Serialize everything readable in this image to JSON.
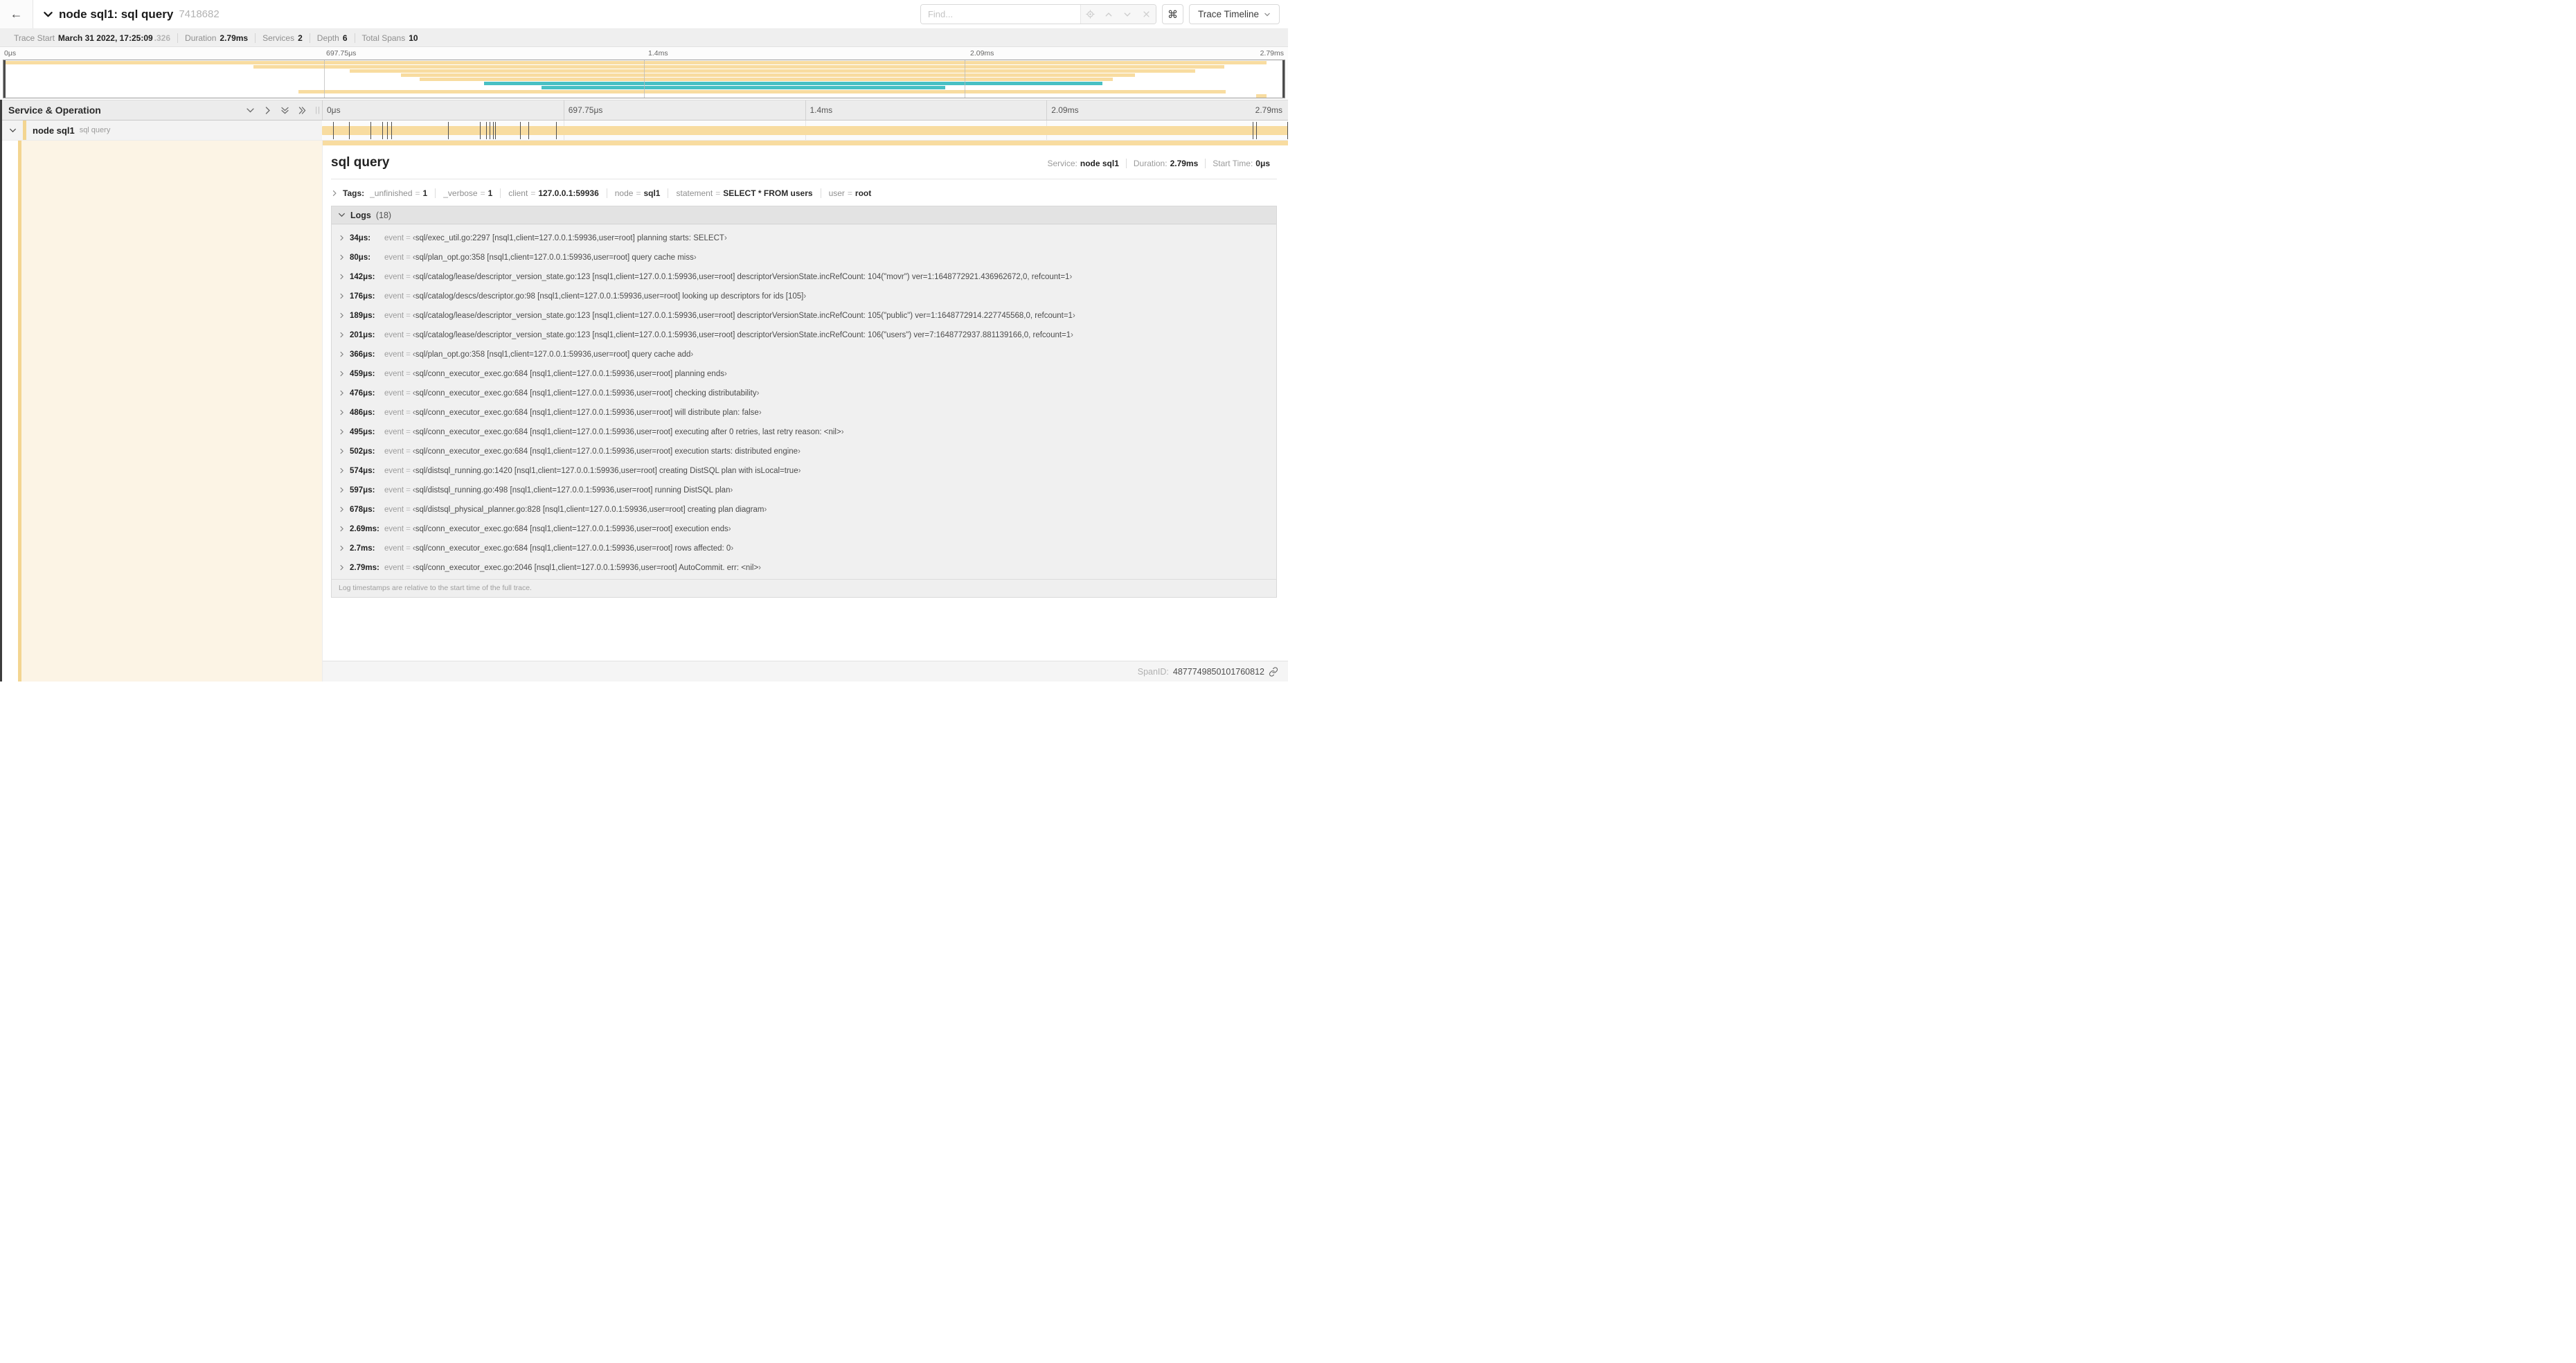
{
  "header": {
    "back_label": "←",
    "title": "node sql1: sql query",
    "trace_id": "7418682",
    "find_placeholder": "Find...",
    "shortcut_key": "⌘",
    "view_selector": "Trace Timeline"
  },
  "stats": [
    {
      "label": "Trace Start",
      "value": "March 31 2022, 17:25:09",
      "suffix": ".326"
    },
    {
      "label": "Duration",
      "value": "2.79ms"
    },
    {
      "label": "Services",
      "value": "2"
    },
    {
      "label": "Depth",
      "value": "6"
    },
    {
      "label": "Total Spans",
      "value": "10"
    }
  ],
  "colors": {
    "span_tan": "#f8dca0",
    "span_teal": "#48c0c4",
    "accent_stripe": "#f3d591",
    "detail_cream": "#fcf4e5"
  },
  "minimap": {
    "total_us": 2790,
    "ticks": [
      {
        "label": "0μs",
        "pos": 0
      },
      {
        "label": "697.75μs",
        "pos": 25
      },
      {
        "label": "1.4ms",
        "pos": 50
      },
      {
        "label": "2.09ms",
        "pos": 75
      },
      {
        "label": "2.79ms",
        "pos": 100
      }
    ],
    "spans": [
      {
        "row": 0,
        "start": 0,
        "end": 98.6,
        "color": "tan"
      },
      {
        "row": 1,
        "start": 19.5,
        "end": 95.3,
        "color": "tan"
      },
      {
        "row": 2,
        "start": 27,
        "end": 93,
        "color": "tan"
      },
      {
        "row": 3,
        "start": 31,
        "end": 88.3,
        "color": "tan"
      },
      {
        "row": 4,
        "start": 32.5,
        "end": 86.6,
        "color": "tan"
      },
      {
        "row": 5,
        "start": 37.5,
        "end": 85.8,
        "color": "teal"
      },
      {
        "row": 6,
        "start": 42,
        "end": 73.5,
        "color": "teal"
      },
      {
        "row": 7,
        "start": 23,
        "end": 95.4,
        "color": "tan"
      },
      {
        "row": 8,
        "start": 97.8,
        "end": 98.6,
        "color": "tan"
      }
    ]
  },
  "timeline": {
    "left_header": "Service & Operation",
    "resizer_glyph": "||",
    "ticks": [
      "0μs",
      "697.75μs",
      "1.4ms",
      "2.09ms",
      "2.79ms"
    ],
    "row": {
      "service": "node sql1",
      "operation": "sql query"
    }
  },
  "detail": {
    "title": "sql query",
    "meta": [
      {
        "label": "Service:",
        "value": "node sql1"
      },
      {
        "label": "Duration:",
        "value": "2.79ms"
      },
      {
        "label": "Start Time:",
        "value": "0μs"
      }
    ],
    "tags_label": "Tags:",
    "tags": [
      {
        "key": "_unfinished",
        "value": "1"
      },
      {
        "key": "_verbose",
        "value": "1"
      },
      {
        "key": "client",
        "value": "127.0.0.1:59936"
      },
      {
        "key": "node",
        "value": "sql1"
      },
      {
        "key": "statement",
        "value": "SELECT * FROM users"
      },
      {
        "key": "user",
        "value": "root"
      }
    ],
    "logs_label": "Logs",
    "logs_count": "(18)",
    "log_key": "event",
    "log_eq": "=",
    "quote_open": "‹",
    "quote_close": "›",
    "logs": [
      {
        "time": "34μs:",
        "t_us": 34,
        "value": "sql/exec_util.go:2297 [nsql1,client=127.0.0.1:59936,user=root] planning starts: SELECT"
      },
      {
        "time": "80μs:",
        "t_us": 80,
        "value": "sql/plan_opt.go:358 [nsql1,client=127.0.0.1:59936,user=root] query cache miss"
      },
      {
        "time": "142μs:",
        "t_us": 142,
        "value": "sql/catalog/lease/descriptor_version_state.go:123 [nsql1,client=127.0.0.1:59936,user=root] descriptorVersionState.incRefCount: 104(\"movr\") ver=1:1648772921.436962672,0, refcount=1"
      },
      {
        "time": "176μs:",
        "t_us": 176,
        "value": "sql/catalog/descs/descriptor.go:98 [nsql1,client=127.0.0.1:59936,user=root] looking up descriptors for ids [105]"
      },
      {
        "time": "189μs:",
        "t_us": 189,
        "value": "sql/catalog/lease/descriptor_version_state.go:123 [nsql1,client=127.0.0.1:59936,user=root] descriptorVersionState.incRefCount: 105(\"public\") ver=1:1648772914.227745568,0, refcount=1"
      },
      {
        "time": "201μs:",
        "t_us": 201,
        "value": "sql/catalog/lease/descriptor_version_state.go:123 [nsql1,client=127.0.0.1:59936,user=root] descriptorVersionState.incRefCount: 106(\"users\") ver=7:1648772937.881139166,0, refcount=1"
      },
      {
        "time": "366μs:",
        "t_us": 366,
        "value": "sql/plan_opt.go:358 [nsql1,client=127.0.0.1:59936,user=root] query cache add"
      },
      {
        "time": "459μs:",
        "t_us": 459,
        "value": "sql/conn_executor_exec.go:684 [nsql1,client=127.0.0.1:59936,user=root] planning ends"
      },
      {
        "time": "476μs:",
        "t_us": 476,
        "value": "sql/conn_executor_exec.go:684 [nsql1,client=127.0.0.1:59936,user=root] checking distributability"
      },
      {
        "time": "486μs:",
        "t_us": 486,
        "value": "sql/conn_executor_exec.go:684 [nsql1,client=127.0.0.1:59936,user=root] will distribute plan: false"
      },
      {
        "time": "495μs:",
        "t_us": 495,
        "value": "sql/conn_executor_exec.go:684 [nsql1,client=127.0.0.1:59936,user=root] executing after 0 retries, last retry reason: <nil>"
      },
      {
        "time": "502μs:",
        "t_us": 502,
        "value": "sql/conn_executor_exec.go:684 [nsql1,client=127.0.0.1:59936,user=root] execution starts: distributed engine"
      },
      {
        "time": "574μs:",
        "t_us": 574,
        "value": "sql/distsql_running.go:1420 [nsql1,client=127.0.0.1:59936,user=root] creating DistSQL plan with isLocal=true"
      },
      {
        "time": "597μs:",
        "t_us": 597,
        "value": "sql/distsql_running.go:498 [nsql1,client=127.0.0.1:59936,user=root] running DistSQL plan"
      },
      {
        "time": "678μs:",
        "t_us": 678,
        "value": "sql/distsql_physical_planner.go:828 [nsql1,client=127.0.0.1:59936,user=root] creating plan diagram"
      },
      {
        "time": "2.69ms:",
        "t_us": 2690,
        "value": "sql/conn_executor_exec.go:684 [nsql1,client=127.0.0.1:59936,user=root] execution ends"
      },
      {
        "time": "2.7ms:",
        "t_us": 2700,
        "value": "sql/conn_executor_exec.go:684 [nsql1,client=127.0.0.1:59936,user=root] rows affected: 0"
      },
      {
        "time": "2.79ms:",
        "t_us": 2790,
        "value": "sql/conn_executor_exec.go:2046 [nsql1,client=127.0.0.1:59936,user=root] AutoCommit. err: <nil>"
      }
    ],
    "footer_note": "Log timestamps are relative to the start time of the full trace.",
    "span_id_label": "SpanID:",
    "span_id": "4877749850101760812"
  }
}
